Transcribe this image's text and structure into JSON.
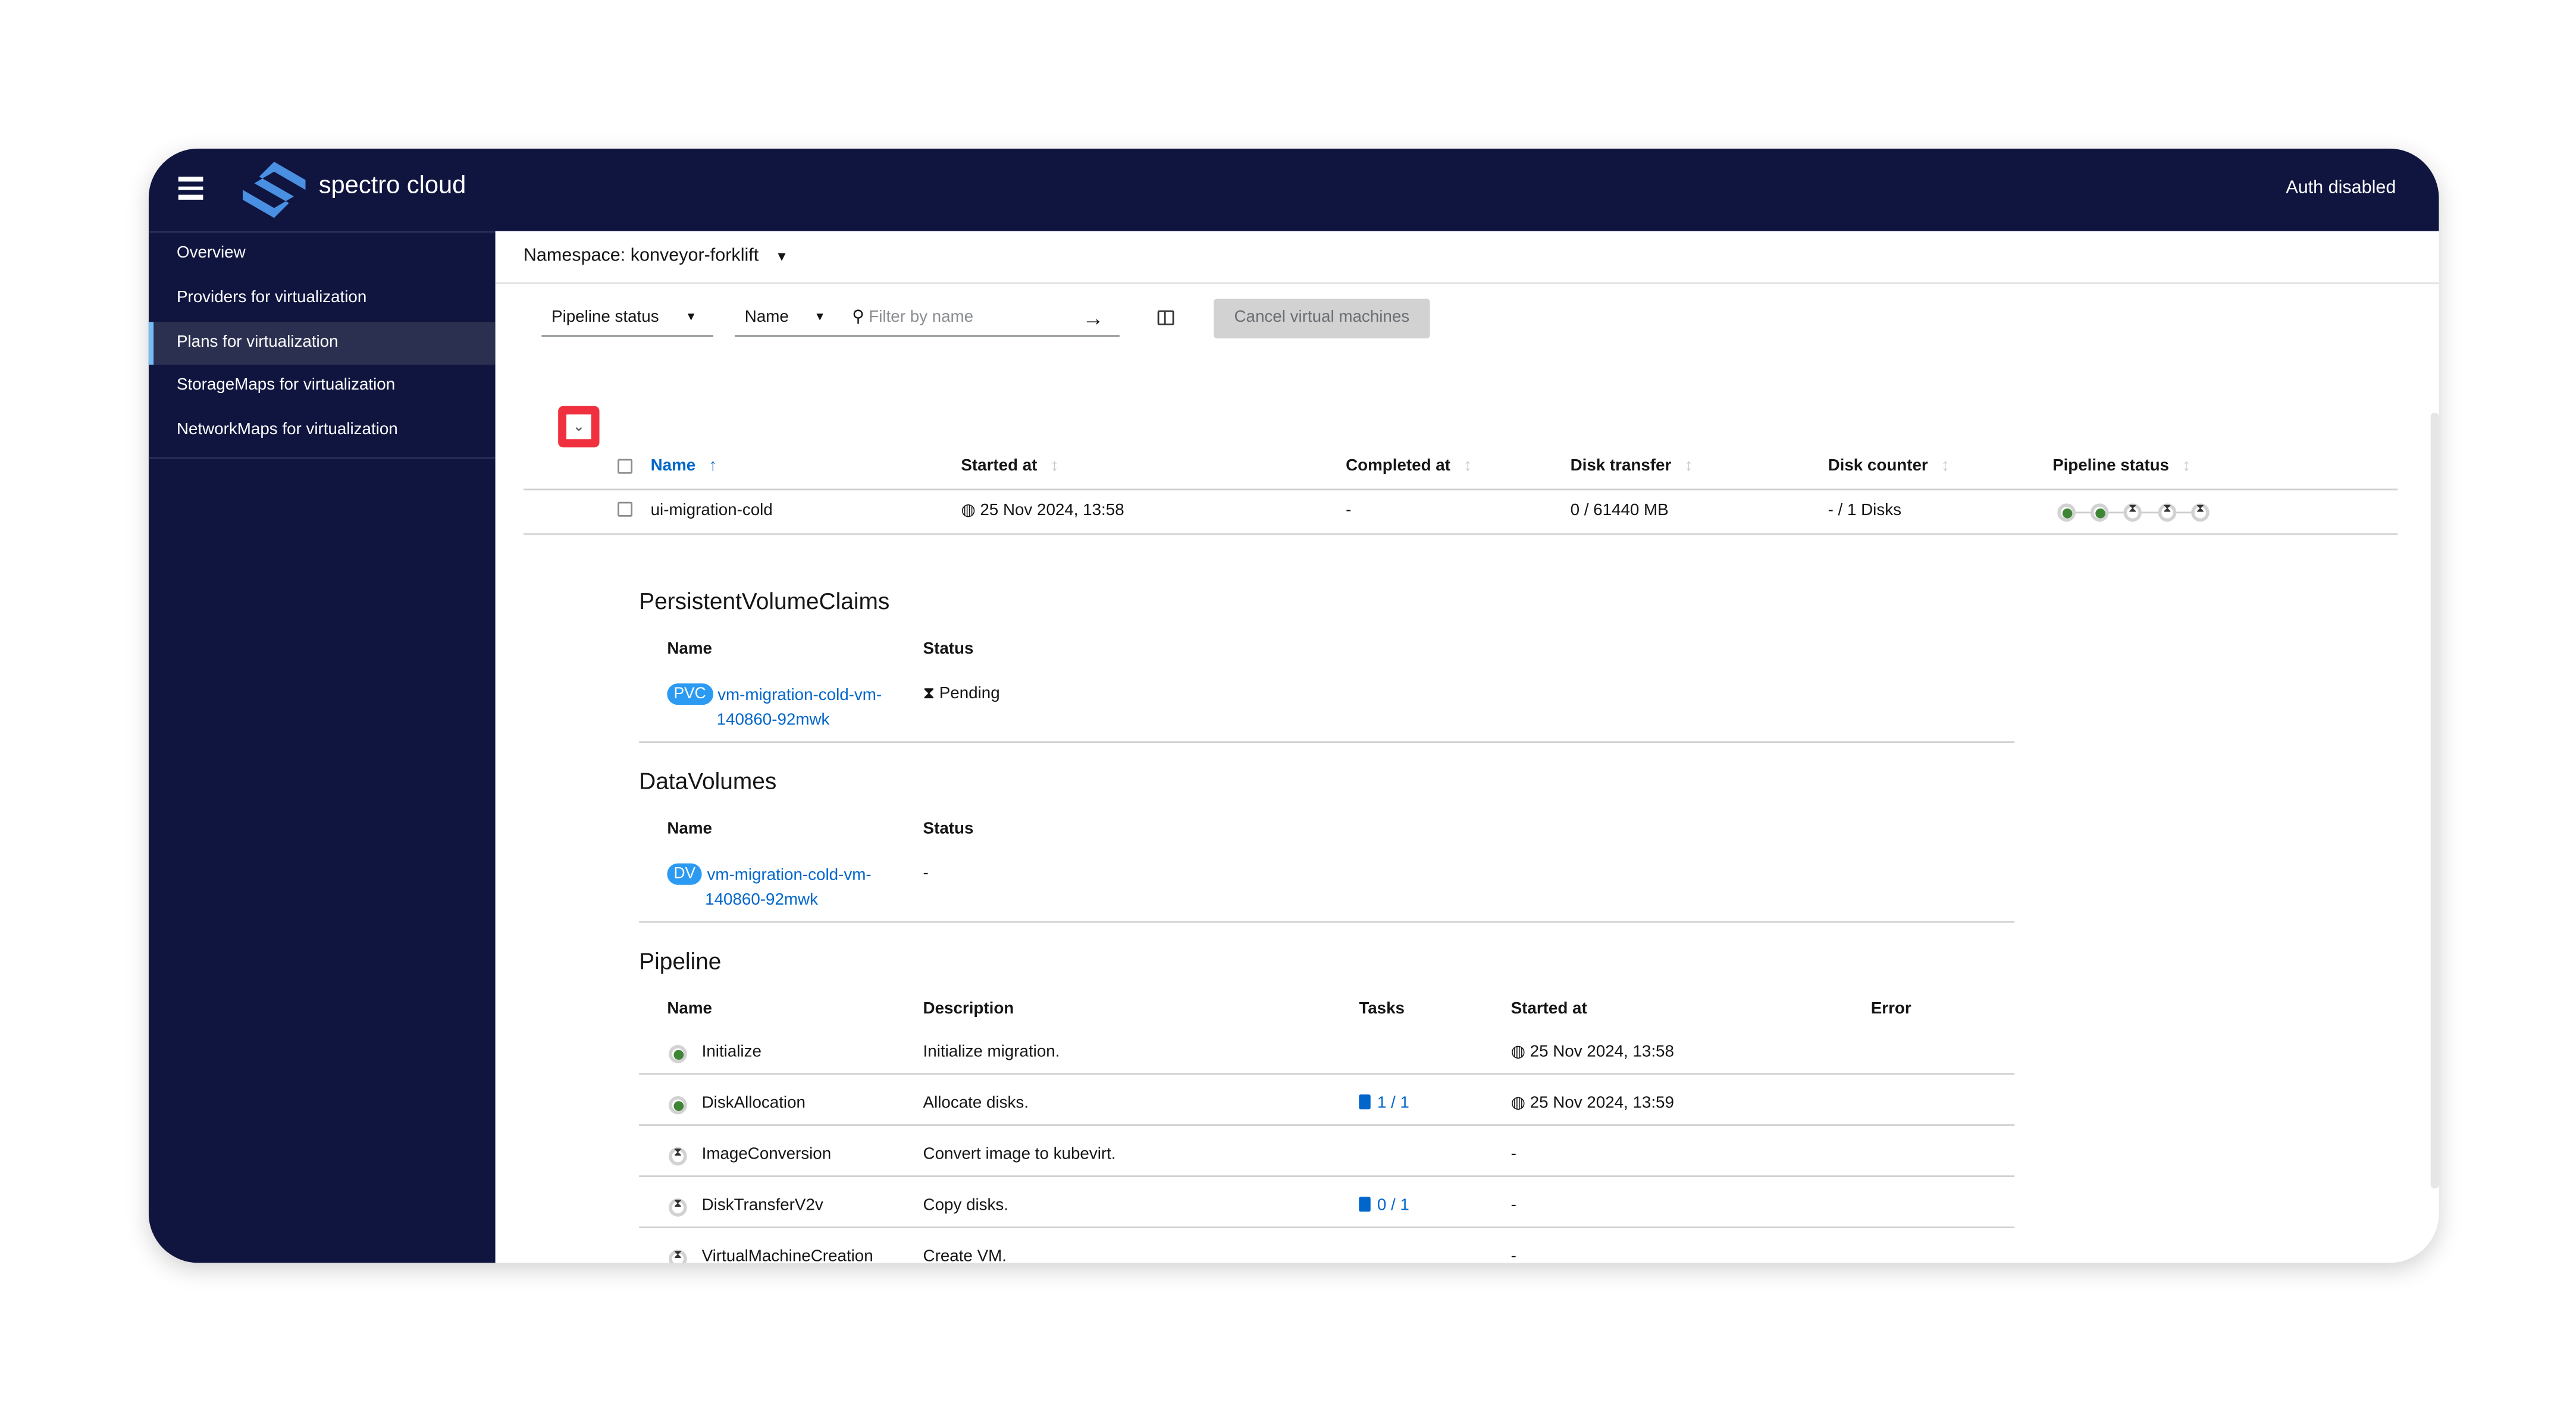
{
  "header": {
    "brand": "spectro cloud",
    "auth_status": "Auth disabled"
  },
  "sidebar": {
    "items": [
      {
        "label": "Overview"
      },
      {
        "label": "Providers for virtualization"
      },
      {
        "label": "Plans for virtualization",
        "active": true
      },
      {
        "label": "StorageMaps for virtualization"
      },
      {
        "label": "NetworkMaps for virtualization"
      }
    ]
  },
  "namespace": {
    "label": "Namespace: konveyor-forklift"
  },
  "toolbar": {
    "filter_type": "Pipeline status",
    "filter_field": "Name",
    "search_placeholder": "Filter by name",
    "cancel_label": "Cancel virtual machines"
  },
  "table": {
    "columns": [
      "Name",
      "Started at",
      "Completed at",
      "Disk transfer",
      "Disk counter",
      "Pipeline status"
    ],
    "rows": [
      {
        "name": "ui-migration-cold",
        "started": "25 Nov 2024, 13:58",
        "completed": "-",
        "disk_transfer": "0 / 61440 MB",
        "disk_counter": "- / 1 Disks",
        "pipeline": [
          "succeeded",
          "succeeded",
          "pending",
          "pending",
          "pending"
        ]
      }
    ]
  },
  "detail": {
    "pvc": {
      "title": "PersistentVolumeClaims",
      "cols": [
        "Name",
        "Status"
      ],
      "badge": "PVC",
      "name_l1": "vm-migration-cold-vm-",
      "name_l2": "140860-92mwk",
      "status": "Pending"
    },
    "dv": {
      "title": "DataVolumes",
      "cols": [
        "Name",
        "Status"
      ],
      "badge": "DV",
      "name_l1": "vm-migration-cold-vm-",
      "name_l2": "140860-92mwk",
      "status": "-"
    },
    "pipeline": {
      "title": "Pipeline",
      "cols": [
        "Name",
        "Description",
        "Tasks",
        "Started at",
        "Error"
      ],
      "rows": [
        {
          "name": "Initialize",
          "status": "succeeded",
          "desc": "Initialize migration.",
          "tasks": "",
          "started": "25 Nov 2024, 13:58"
        },
        {
          "name": "DiskAllocation",
          "status": "succeeded",
          "desc": "Allocate disks.",
          "tasks": "1 / 1",
          "started": "25 Nov 2024, 13:59"
        },
        {
          "name": "ImageConversion",
          "status": "pending",
          "desc": "Convert image to kubevirt.",
          "tasks": "",
          "started": "-"
        },
        {
          "name": "DiskTransferV2v",
          "status": "pending",
          "desc": "Copy disks.",
          "tasks": "0 / 1",
          "started": "-"
        },
        {
          "name": "VirtualMachineCreation",
          "status": "pending",
          "desc": "Create VM.",
          "tasks": "",
          "started": "-"
        }
      ]
    }
  },
  "colors": {
    "nav_bg": "#10153f",
    "accent": "#06c",
    "success": "#3e8635",
    "highlight": "#f0303f"
  }
}
